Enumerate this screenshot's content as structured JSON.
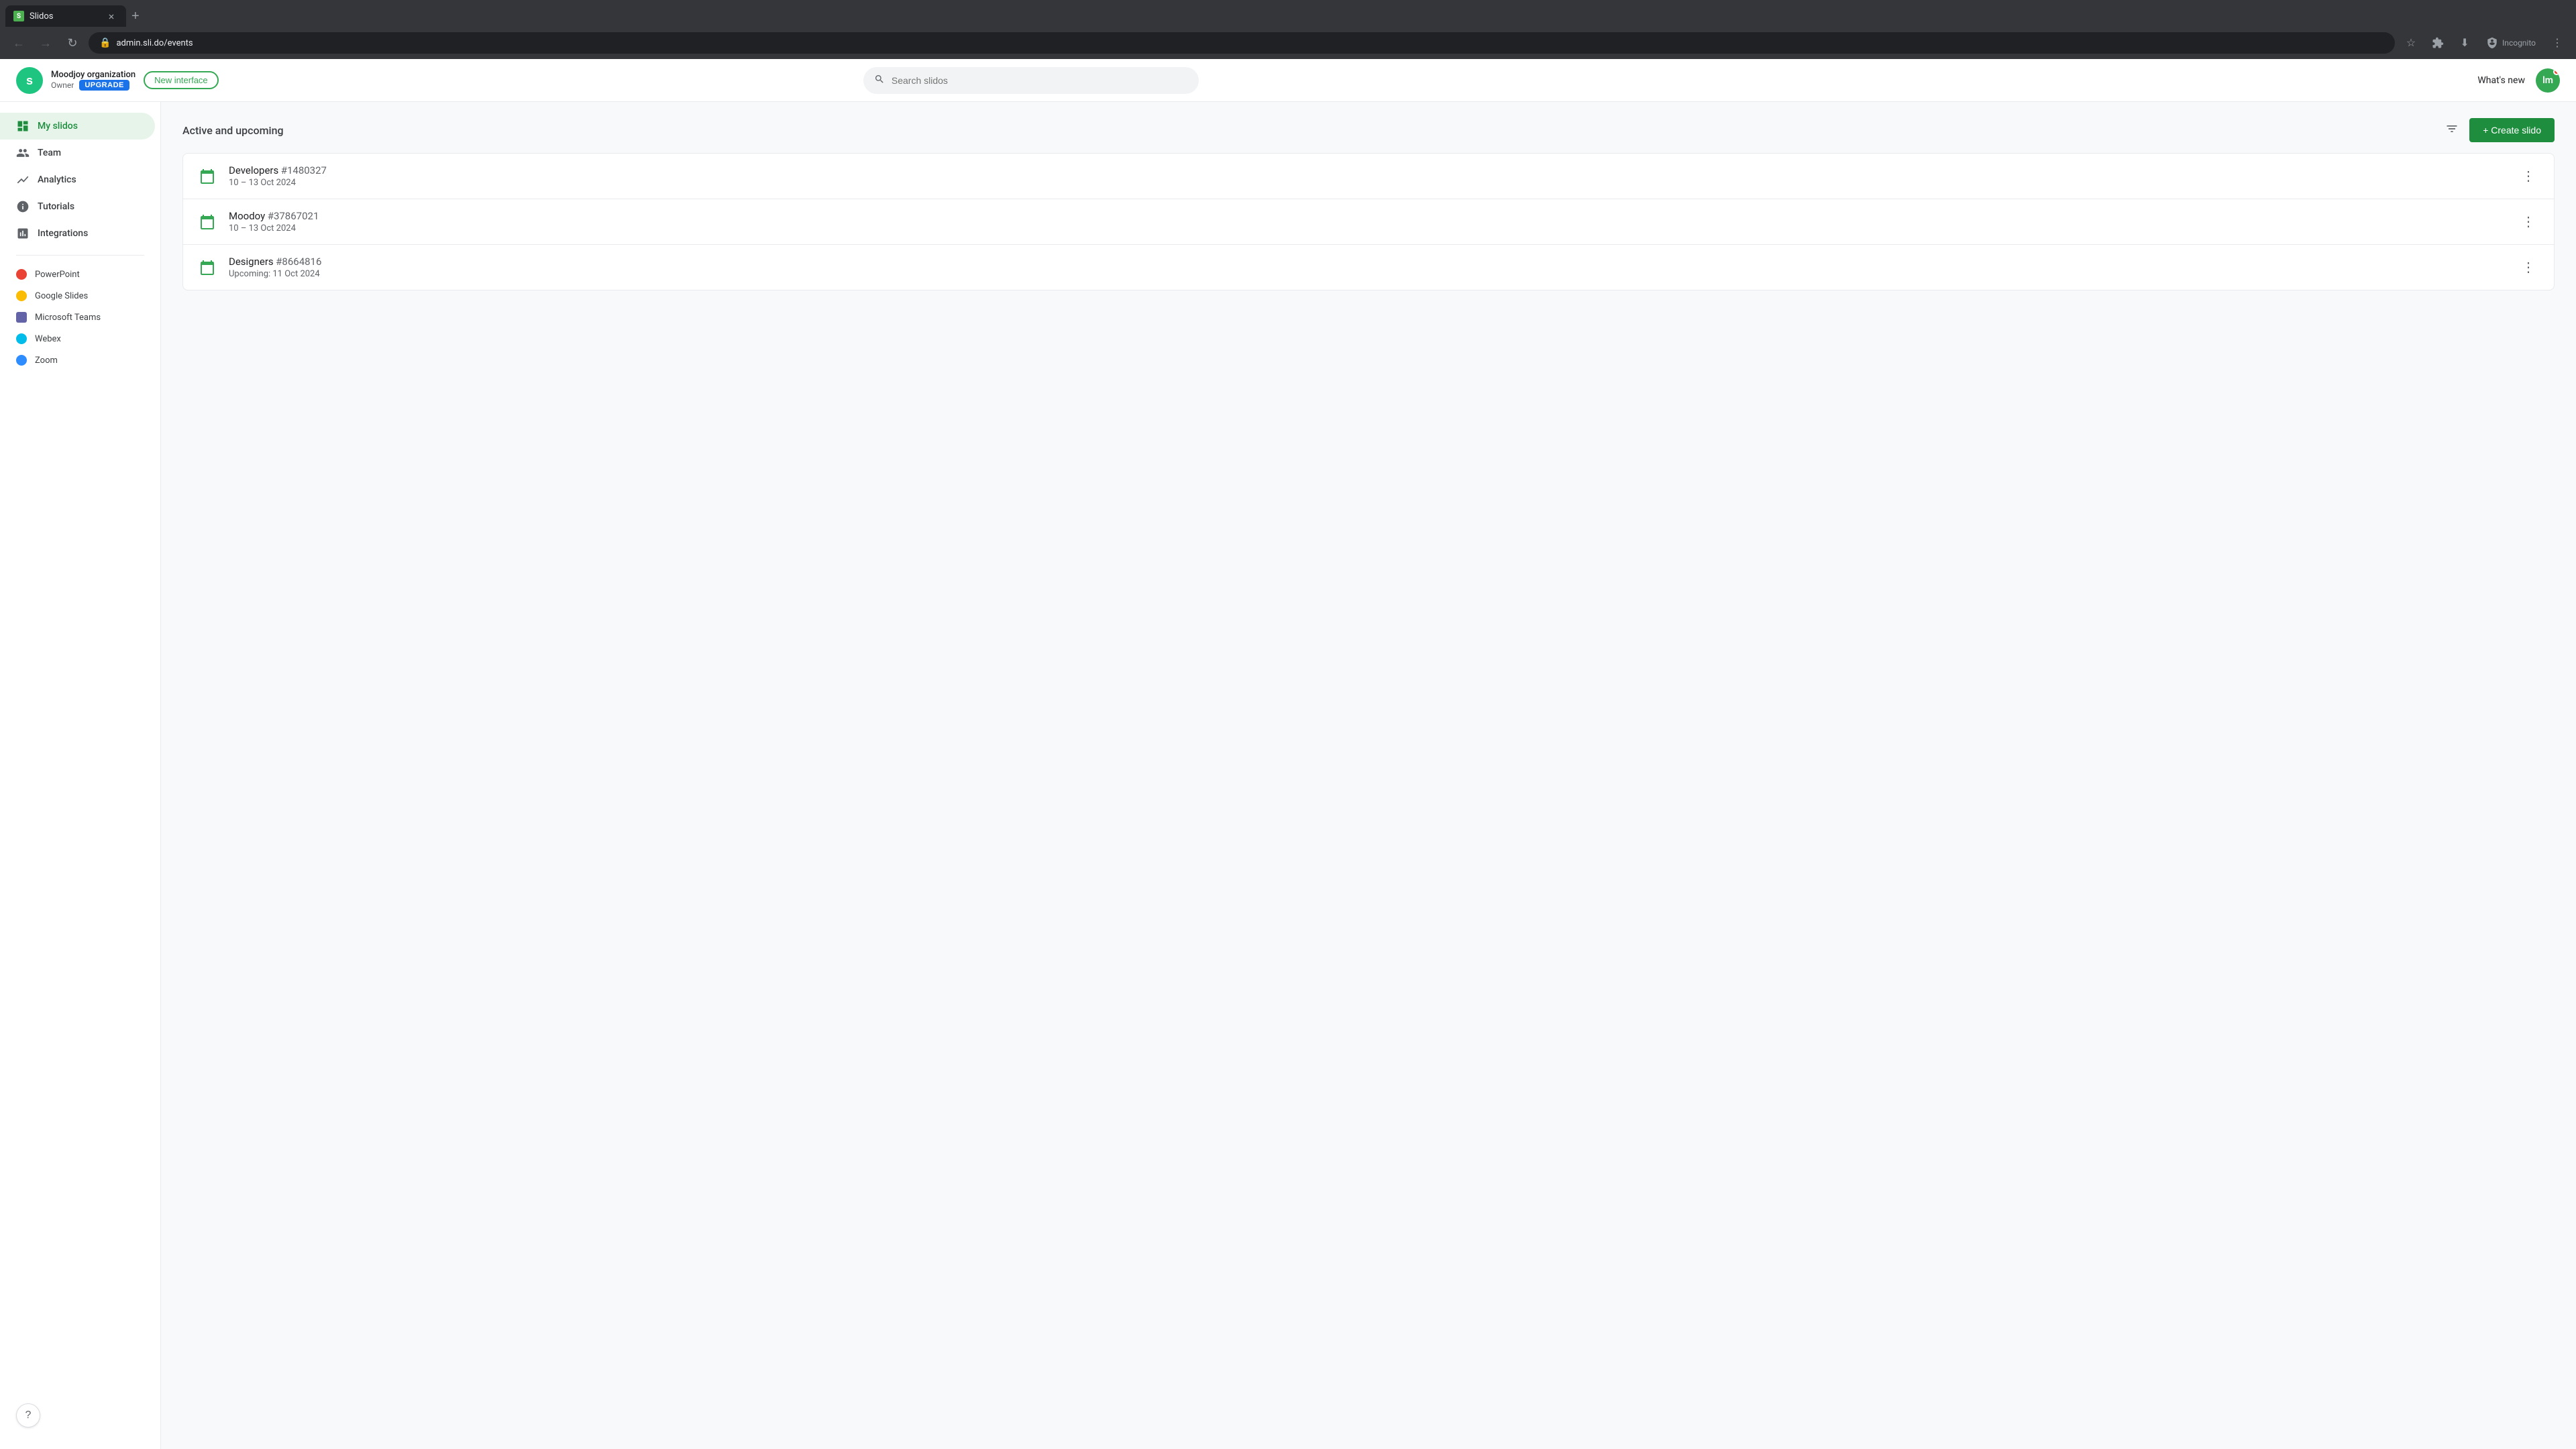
{
  "browser": {
    "tab": {
      "favicon": "S",
      "title": "Slidos",
      "close": "×"
    },
    "new_tab": "+",
    "nav": {
      "back": "←",
      "forward": "→",
      "reload": "↻",
      "url": "admin.sli.do/events"
    },
    "actions": {
      "bookmark": "☆",
      "extensions": "🧩",
      "download": "⬇",
      "incognito": "Incognito",
      "more": "⋮"
    }
  },
  "header": {
    "logo_text": "slido",
    "org_name": "Moodjoy organization",
    "role": "Owner",
    "upgrade_label": "UPGRADE",
    "new_interface_label": "New interface",
    "search_placeholder": "Search slidos",
    "whats_new": "What's new",
    "avatar_initials": "lm"
  },
  "sidebar": {
    "items": [
      {
        "id": "my-slidos",
        "label": "My slidos",
        "active": true
      },
      {
        "id": "team",
        "label": "Team",
        "active": false
      },
      {
        "id": "analytics",
        "label": "Analytics",
        "active": false
      },
      {
        "id": "tutorials",
        "label": "Tutorials",
        "active": false
      },
      {
        "id": "integrations",
        "label": "Integrations",
        "active": false
      }
    ],
    "integrations": [
      {
        "id": "powerpoint",
        "label": "PowerPoint",
        "color": "#ea4335"
      },
      {
        "id": "google-slides",
        "label": "Google Slides",
        "color": "#fbbc04"
      },
      {
        "id": "microsoft-teams",
        "label": "Microsoft Teams",
        "color": "#6264a7"
      },
      {
        "id": "webex",
        "label": "Webex",
        "color": "#00bceb"
      },
      {
        "id": "zoom",
        "label": "Zoom",
        "color": "#2d8cff"
      }
    ],
    "help_label": "?"
  },
  "content": {
    "section_title": "Active and upcoming",
    "create_button": "+ Create slido",
    "events": [
      {
        "id": "event-1",
        "name": "Developers",
        "event_id": "#1480327",
        "date": "10 – 13 Oct 2024",
        "upcoming": false
      },
      {
        "id": "event-2",
        "name": "Moodoy",
        "event_id": "#37867021",
        "date": "10 – 13 Oct 2024",
        "upcoming": false
      },
      {
        "id": "event-3",
        "name": "Designers",
        "event_id": "#8664816",
        "date": "11 Oct 2024",
        "upcoming": true,
        "upcoming_label": "Upcoming:"
      }
    ]
  }
}
